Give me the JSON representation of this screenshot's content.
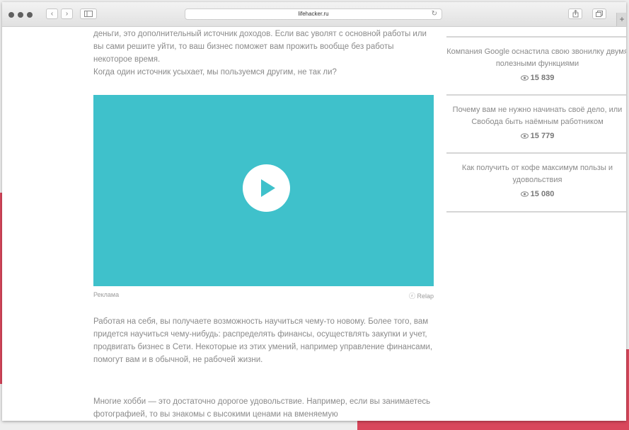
{
  "browser": {
    "url": "lifehacker.ru"
  },
  "article": {
    "para1": "деньги, это дополнительный источник доходов. Если вас уволят с основной работы или вы сами решите уйти, то ваш бизнес поможет вам прожить вообще без работы некоторое время.",
    "para1b": "Когда один источник усыхает, мы пользуемся другим, не так ли?",
    "ad_label": "Реклама",
    "ad_brand": "Relap",
    "para2": "Работая на себя, вы получаете возможность научиться чему-то новому. Более того, вам придется научиться чему-нибудь: распределять финансы, осуществлять закупки и учет, продвигать бизнес в Сети. Некоторые из этих умений, например управление финансами, помогут вам и в обычной, не рабочей жизни.",
    "para3": "Многие хобби — это достаточно дорогое удовольствие. Например, если вы занимаетесь фотографией, то вы знакомы с высокими ценами на вменяемую"
  },
  "video": {
    "color": "#3fc1cb",
    "icon": "play-icon"
  },
  "sidebar": {
    "items": [
      {
        "title": "Компания Google оснастила свою звонилку двумя полезными функциями",
        "views": "15 839"
      },
      {
        "title": "Почему вам не нужно начинать своё дело, или Свобода быть наёмным работником",
        "views": "15 779"
      },
      {
        "title": "Как получить от кофе максимум пользы и удовольствия",
        "views": "15 080"
      }
    ]
  },
  "colors": {
    "accent_red": "#d9475c",
    "text_gray": "#8a8a8a"
  }
}
